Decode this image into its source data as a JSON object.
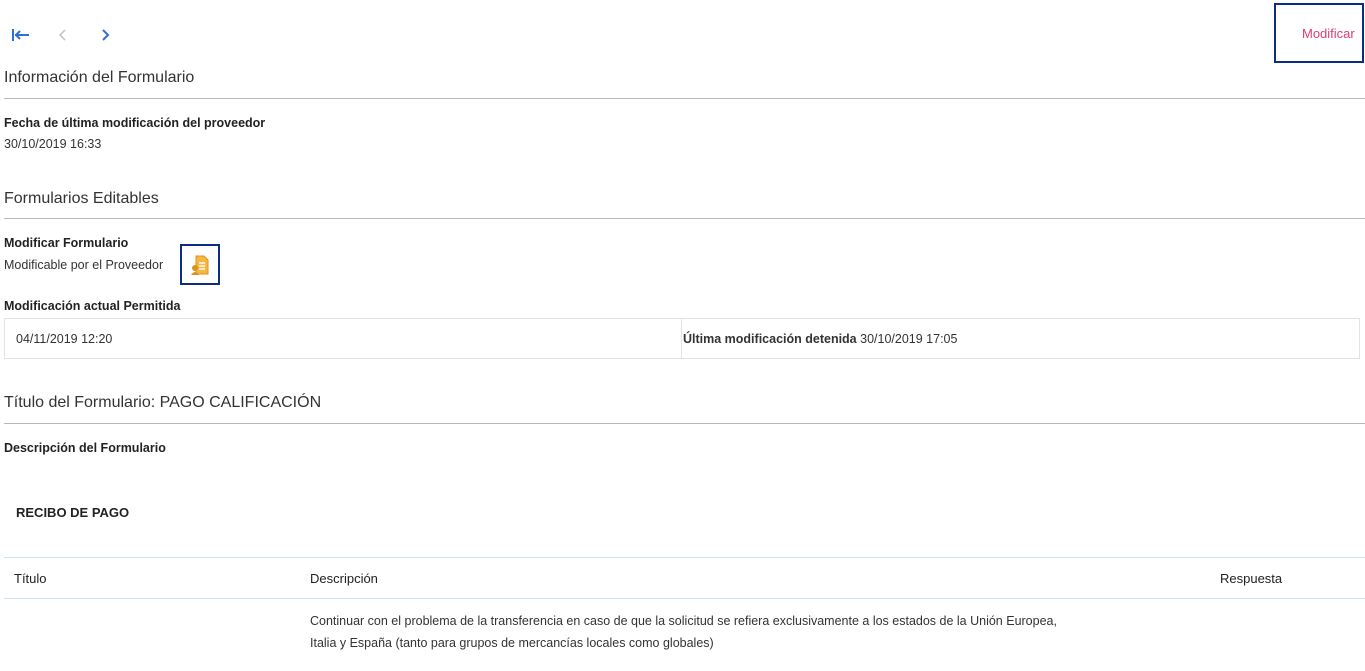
{
  "toolbar": {
    "first_icon": "first-page-icon",
    "prev_icon": "chevron-left-icon",
    "next_icon": "chevron-right-icon",
    "modify_label": "Modificar",
    "accent_color": "#d63f77",
    "nav_color": "#2f6fd6"
  },
  "form_info": {
    "title": "Información del Formulario",
    "last_modified_label": "Fecha de última modificación del proveedor",
    "last_modified_value": "30/10/2019 16:33"
  },
  "editable": {
    "title": "Formularios Editables",
    "modify_label": "Modificar Formulario",
    "modifiable_text": "Modificable por el Proveedor",
    "edit_icon": "document-edit-icon",
    "current_allowed_label": "Modificación actual Permitida",
    "current_allowed_value": "04/11/2019 12:20",
    "last_stopped_label": "Última modificación detenida",
    "last_stopped_value": "30/10/2019 17:05"
  },
  "form": {
    "title": "Título del Formulario: PAGO CALIFICACIÓN",
    "description_label": "Descripción del Formulario",
    "section_heading": "RECIBO DE PAGO"
  },
  "table": {
    "headers": [
      "Título",
      "Descripción",
      "Respuesta"
    ],
    "row1_lines": [
      "Continuar con el problema de la transferencia en caso de que la solicitud se refiera exclusivamente a los estados de la Unión Europea,",
      "Italia y España (tanto para grupos de mercancías locales como globales)"
    ]
  }
}
